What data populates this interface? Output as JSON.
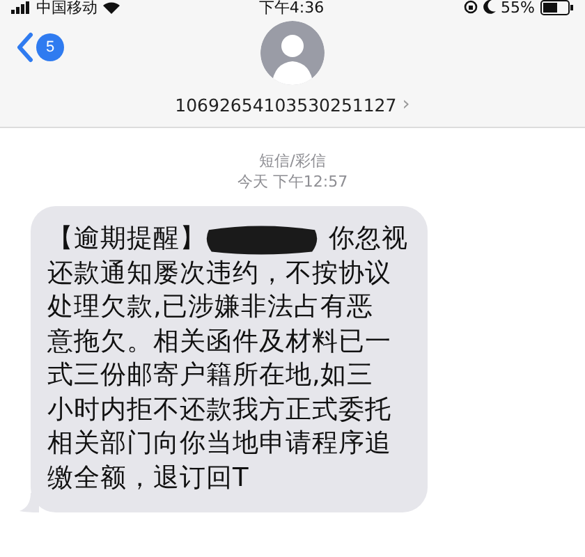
{
  "status_bar": {
    "carrier": "中国移动",
    "time": "下午4:36",
    "battery": "55%"
  },
  "header": {
    "unread_count": "5",
    "contact": "10692654103530251127",
    "chevron": "›"
  },
  "thread": {
    "service": "短信/彩信",
    "timestamp": "今天 下午12:57"
  },
  "message": {
    "prefix": "【逾期提醒】",
    "after_redaction": "你忽视",
    "body": "还款通知屡次违约，不按协议处理欠款,已涉嫌非法占有恶意拖欠。相关函件及材料已一式三份邮寄户籍所在地,如三小时内拒不还款我方正式委托相关部门向你当地申请程序追缴全额，退订回T"
  }
}
